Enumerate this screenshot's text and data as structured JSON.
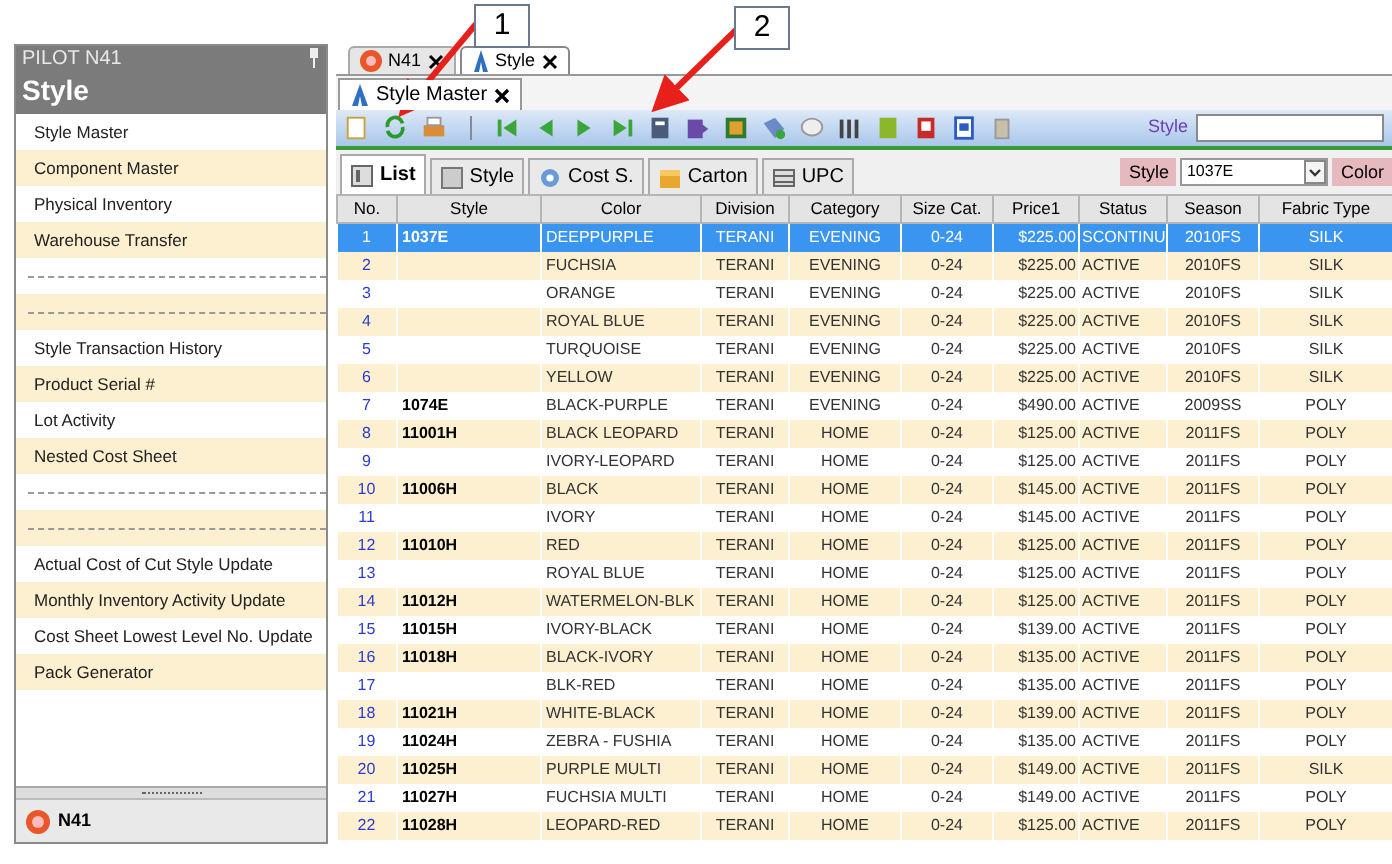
{
  "sidebar": {
    "app_title": "PILOT N41",
    "module_title": "Style",
    "items": [
      {
        "kind": "item",
        "label": "Style Master"
      },
      {
        "kind": "item",
        "label": "Component Master"
      },
      {
        "kind": "item",
        "label": "Physical Inventory"
      },
      {
        "kind": "item",
        "label": "Warehouse Transfer"
      },
      {
        "kind": "separator"
      },
      {
        "kind": "separator"
      },
      {
        "kind": "item",
        "label": "Style Transaction History"
      },
      {
        "kind": "item",
        "label": "Product Serial #"
      },
      {
        "kind": "item",
        "label": "Lot Activity"
      },
      {
        "kind": "item",
        "label": "Nested Cost Sheet"
      },
      {
        "kind": "separator"
      },
      {
        "kind": "separator"
      },
      {
        "kind": "item",
        "label": "Actual Cost of Cut Style Update"
      },
      {
        "kind": "item",
        "label": "Monthly Inventory Activity Update"
      },
      {
        "kind": "item",
        "label": "Cost Sheet Lowest Level No. Update"
      },
      {
        "kind": "item",
        "label": "Pack Generator"
      }
    ],
    "footer": "N41"
  },
  "document_tabs": [
    {
      "label": "N41",
      "selected": false
    },
    {
      "label": "Style",
      "selected": true
    }
  ],
  "sub_tab": {
    "label": "Style Master"
  },
  "toolbar": {
    "search_label": "Style"
  },
  "view_tabs": [
    {
      "label": "List",
      "selected": true
    },
    {
      "label": "Style",
      "selected": false
    },
    {
      "label": "Cost S.",
      "selected": false
    },
    {
      "label": "Carton",
      "selected": false
    },
    {
      "label": "UPC",
      "selected": false
    }
  ],
  "filter": {
    "style_label": "Style",
    "style_value": "1037E",
    "color_label": "Color"
  },
  "table": {
    "columns": [
      "No.",
      "Style",
      "Color",
      "Division",
      "Category",
      "Size Cat.",
      "Price1",
      "Status",
      "Season",
      "Fabric Type"
    ],
    "rows": [
      {
        "selected": true,
        "cells": [
          "1",
          "1037E",
          "DEEPPURPLE",
          "TERANI",
          "EVENING",
          "0-24",
          "$225.00",
          "SCONTINU",
          "2010FS",
          "SILK"
        ]
      },
      {
        "selected": false,
        "cells": [
          "2",
          "",
          "FUCHSIA",
          "TERANI",
          "EVENING",
          "0-24",
          "$225.00",
          "ACTIVE",
          "2010FS",
          "SILK"
        ]
      },
      {
        "selected": false,
        "cells": [
          "3",
          "",
          "ORANGE",
          "TERANI",
          "EVENING",
          "0-24",
          "$225.00",
          "ACTIVE",
          "2010FS",
          "SILK"
        ]
      },
      {
        "selected": false,
        "cells": [
          "4",
          "",
          "ROYAL BLUE",
          "TERANI",
          "EVENING",
          "0-24",
          "$225.00",
          "ACTIVE",
          "2010FS",
          "SILK"
        ]
      },
      {
        "selected": false,
        "cells": [
          "5",
          "",
          "TURQUOISE",
          "TERANI",
          "EVENING",
          "0-24",
          "$225.00",
          "ACTIVE",
          "2010FS",
          "SILK"
        ]
      },
      {
        "selected": false,
        "cells": [
          "6",
          "",
          "YELLOW",
          "TERANI",
          "EVENING",
          "0-24",
          "$225.00",
          "ACTIVE",
          "2010FS",
          "SILK"
        ]
      },
      {
        "selected": false,
        "cells": [
          "7",
          "1074E",
          "BLACK-PURPLE",
          "TERANI",
          "EVENING",
          "0-24",
          "$490.00",
          "ACTIVE",
          "2009SS",
          "POLY"
        ]
      },
      {
        "selected": false,
        "cells": [
          "8",
          "11001H",
          "BLACK LEOPARD",
          "TERANI",
          "HOME",
          "0-24",
          "$125.00",
          "ACTIVE",
          "2011FS",
          "POLY"
        ]
      },
      {
        "selected": false,
        "cells": [
          "9",
          "",
          "IVORY-LEOPARD",
          "TERANI",
          "HOME",
          "0-24",
          "$125.00",
          "ACTIVE",
          "2011FS",
          "POLY"
        ]
      },
      {
        "selected": false,
        "cells": [
          "10",
          "11006H",
          "BLACK",
          "TERANI",
          "HOME",
          "0-24",
          "$145.00",
          "ACTIVE",
          "2011FS",
          "POLY"
        ]
      },
      {
        "selected": false,
        "cells": [
          "11",
          "",
          "IVORY",
          "TERANI",
          "HOME",
          "0-24",
          "$145.00",
          "ACTIVE",
          "2011FS",
          "POLY"
        ]
      },
      {
        "selected": false,
        "cells": [
          "12",
          "11010H",
          "RED",
          "TERANI",
          "HOME",
          "0-24",
          "$125.00",
          "ACTIVE",
          "2011FS",
          "POLY"
        ]
      },
      {
        "selected": false,
        "cells": [
          "13",
          "",
          "ROYAL BLUE",
          "TERANI",
          "HOME",
          "0-24",
          "$125.00",
          "ACTIVE",
          "2011FS",
          "POLY"
        ]
      },
      {
        "selected": false,
        "cells": [
          "14",
          "11012H",
          "WATERMELON-BLK",
          "TERANI",
          "HOME",
          "0-24",
          "$125.00",
          "ACTIVE",
          "2011FS",
          "POLY"
        ]
      },
      {
        "selected": false,
        "cells": [
          "15",
          "11015H",
          "IVORY-BLACK",
          "TERANI",
          "HOME",
          "0-24",
          "$139.00",
          "ACTIVE",
          "2011FS",
          "POLY"
        ]
      },
      {
        "selected": false,
        "cells": [
          "16",
          "11018H",
          "BLACK-IVORY",
          "TERANI",
          "HOME",
          "0-24",
          "$135.00",
          "ACTIVE",
          "2011FS",
          "POLY"
        ]
      },
      {
        "selected": false,
        "cells": [
          "17",
          "",
          "BLK-RED",
          "TERANI",
          "HOME",
          "0-24",
          "$135.00",
          "ACTIVE",
          "2011FS",
          "POLY"
        ]
      },
      {
        "selected": false,
        "cells": [
          "18",
          "11021H",
          "WHITE-BLACK",
          "TERANI",
          "HOME",
          "0-24",
          "$139.00",
          "ACTIVE",
          "2011FS",
          "POLY"
        ]
      },
      {
        "selected": false,
        "cells": [
          "19",
          "11024H",
          "ZEBRA - FUSHIA",
          "TERANI",
          "HOME",
          "0-24",
          "$135.00",
          "ACTIVE",
          "2011FS",
          "POLY"
        ]
      },
      {
        "selected": false,
        "cells": [
          "20",
          "11025H",
          "PURPLE MULTI",
          "TERANI",
          "HOME",
          "0-24",
          "$149.00",
          "ACTIVE",
          "2011FS",
          "SILK"
        ]
      },
      {
        "selected": false,
        "cells": [
          "21",
          "11027H",
          "FUCHSIA MULTI",
          "TERANI",
          "HOME",
          "0-24",
          "$149.00",
          "ACTIVE",
          "2011FS",
          "POLY"
        ]
      },
      {
        "selected": false,
        "cells": [
          "22",
          "11028H",
          "LEOPARD-RED",
          "TERANI",
          "HOME",
          "0-24",
          "$125.00",
          "ACTIVE",
          "2011FS",
          "POLY"
        ]
      }
    ]
  },
  "callouts": [
    "1",
    "2"
  ]
}
